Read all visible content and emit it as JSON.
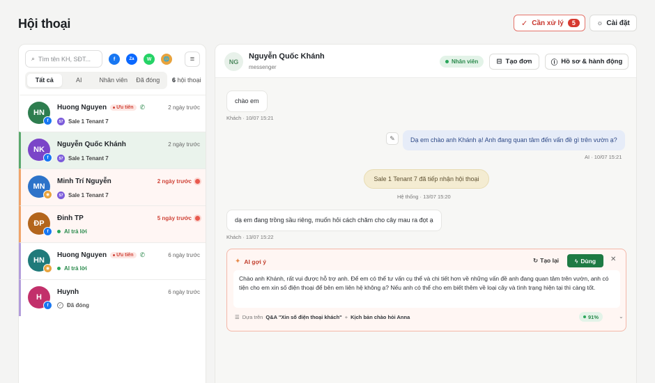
{
  "page": {
    "title": "Hội thoại"
  },
  "toolbar": {
    "needs_label": "Cần xử lý",
    "needs_count": "5",
    "settings_label": "Cài đặt"
  },
  "sidebar": {
    "search_placeholder": "Tìm tên KH, SĐT...",
    "channels": [
      "f",
      "Za",
      "W",
      "🌐"
    ],
    "tabs": [
      "Tất cả",
      "AI",
      "Nhân viên",
      "Đã đóng"
    ],
    "count_num": "6",
    "count_label": "hội thoại",
    "conversations": [
      {
        "initials": "HN",
        "avatar_color": "#2e7d4f",
        "name": "Huong Nguyen",
        "priority": "Ưu tiên",
        "time": "2 ngày trước",
        "sub_badge": "S7",
        "sub": "Sale 1 Tenant 7"
      },
      {
        "initials": "NK",
        "avatar_color": "#7b45c8",
        "name": "Nguyễn Quốc Khánh",
        "time": "2 ngày trước",
        "sub_badge": "S7",
        "sub": "Sale 1 Tenant 7"
      },
      {
        "initials": "MN",
        "avatar_color": "#2d73c9",
        "name": "Minh Trí Nguyễn",
        "time": "2 ngày trước",
        "sub_badge": "S7",
        "sub": "Sale 1 Tenant 7"
      },
      {
        "initials": "ĐP",
        "avatar_color": "#b3651c",
        "name": "Đinh TP",
        "time": "5 ngày trước",
        "sub": "AI trả lời"
      },
      {
        "initials": "HN",
        "avatar_color": "#1f7a7a",
        "name": "Huong Nguyen",
        "priority": "Ưu tiên",
        "time": "6 ngày trước",
        "sub": "AI trả lời"
      },
      {
        "initials": "H",
        "avatar_color": "#c2306b",
        "name": "Huynh",
        "time": "6 ngày trước",
        "sub": "Đã đóng"
      }
    ]
  },
  "chat": {
    "avatar": "NG",
    "name": "Nguyễn Quốc Khánh",
    "channel": "messenger",
    "status": "Nhân viên",
    "create_order": "Tạo đơn",
    "profile_actions": "Hồ sơ & hành động",
    "messages": [
      {
        "text": "chào em",
        "meta": "Khách · 10/07 15:21"
      },
      {
        "text": "Dạ em chào anh Khánh ạ! Anh đang quan tâm đến vấn đề gì trên vườn ạ?",
        "meta": "AI · 10/07 15:21"
      },
      {
        "text": "Sale 1 Tenant 7 đã tiếp nhận hội thoại",
        "meta": "Hệ thống · 13/07 15:20"
      },
      {
        "text": "dạ em đang trồng sầu riêng, muốn hỏi cách chăm cho cây mau ra đọt ạ",
        "meta": "Khách · 13/07 15:22"
      }
    ],
    "suggestion": {
      "title": "AI gợi ý",
      "redo": "Tạo lại",
      "use": "Dùng",
      "body": "Chào anh Khánh, rất vui được hỗ trợ anh. Để em có thể tư vấn cụ thể và chi tiết hơn về những vấn đề anh đang quan tâm trên vườn, anh có tiện cho em xin số điện thoại để bên em liên hệ không ạ? Nếu anh có thể cho em biết thêm về loại cây và tình trạng hiện tại thì càng tốt.",
      "source_prefix": "Dựa trên",
      "source_qa": "Q&A \"Xin số điện thoại khách\"",
      "source_plus": "+",
      "source_script": "Kịch bản chào hỏi Anna",
      "confidence": "91%"
    }
  }
}
